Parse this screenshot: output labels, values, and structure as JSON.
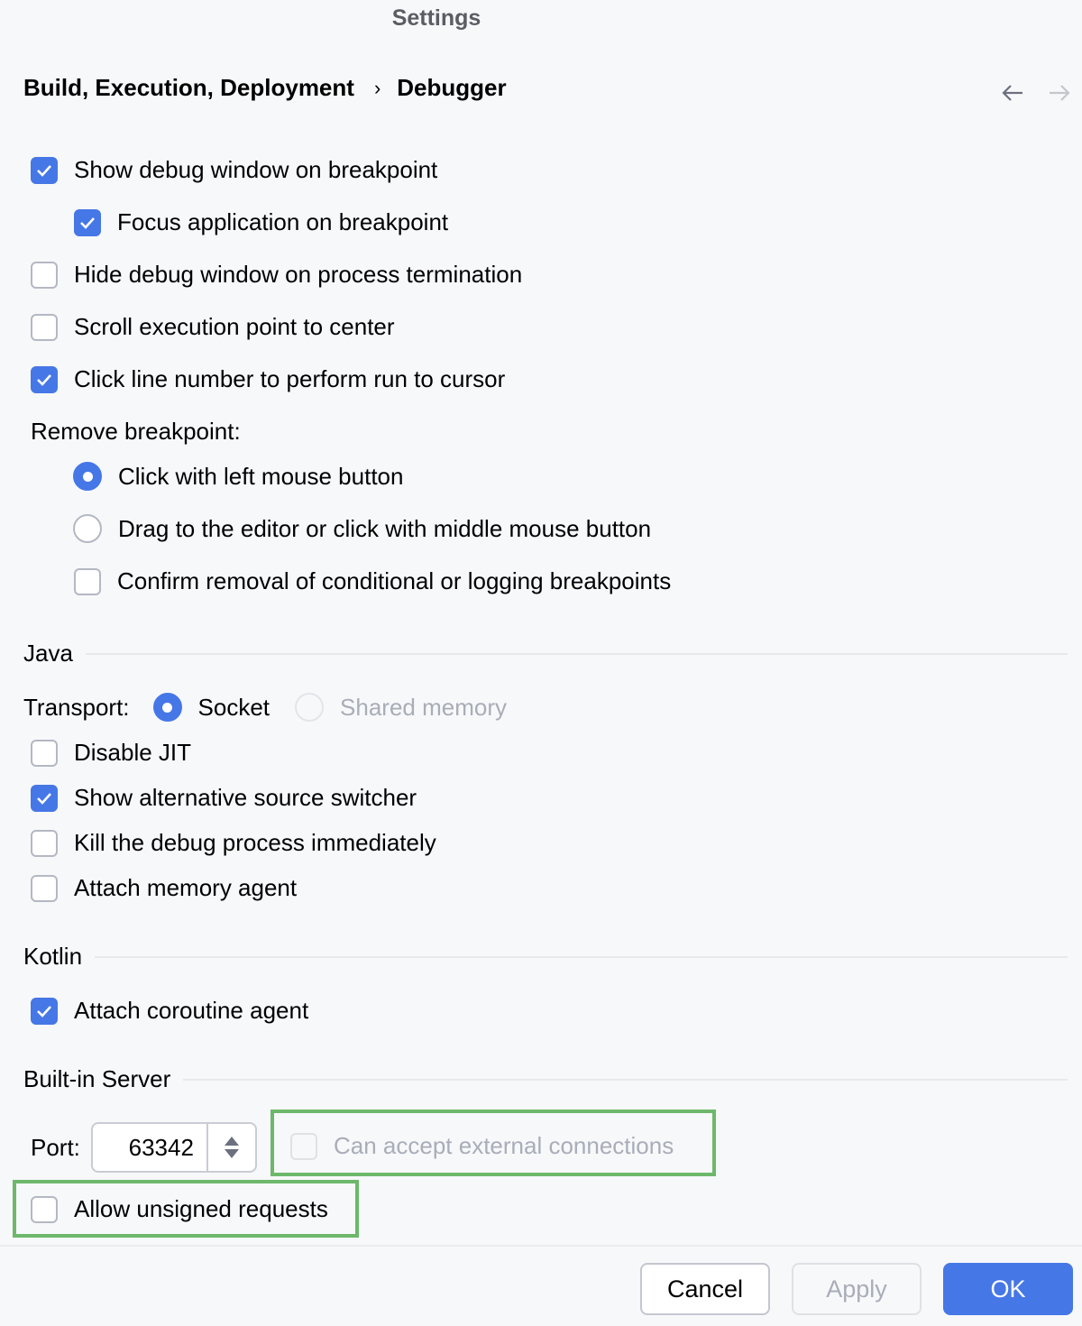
{
  "window": {
    "title": "Settings"
  },
  "breadcrumb": {
    "parent": "Build, Execution, Deployment",
    "separator": "›",
    "current": "Debugger"
  },
  "nav": {
    "back_icon": "arrow-left-icon",
    "forward_icon": "arrow-right-icon"
  },
  "general": {
    "show_debug_window": {
      "label": "Show debug window on breakpoint",
      "checked": true
    },
    "focus_application": {
      "label": "Focus application on breakpoint",
      "checked": true
    },
    "hide_debug_window": {
      "label": "Hide debug window on process termination",
      "checked": false
    },
    "scroll_execution": {
      "label": "Scroll execution point to center",
      "checked": false
    },
    "click_line_number": {
      "label": "Click line number to perform run to cursor",
      "checked": true
    }
  },
  "remove_breakpoint": {
    "label": "Remove breakpoint:",
    "options": [
      {
        "label": "Click with left mouse button",
        "selected": true
      },
      {
        "label": "Drag to the editor or click with middle mouse button",
        "selected": false
      }
    ],
    "confirm_removal": {
      "label": "Confirm removal of conditional or logging breakpoints",
      "checked": false
    }
  },
  "java": {
    "header": "Java",
    "transport_label": "Transport:",
    "transport_options": [
      {
        "label": "Socket",
        "selected": true,
        "enabled": true
      },
      {
        "label": "Shared memory",
        "selected": false,
        "enabled": false
      }
    ],
    "disable_jit": {
      "label": "Disable JIT",
      "checked": false
    },
    "alt_source_switcher": {
      "label": "Show alternative source switcher",
      "checked": true
    },
    "kill_debug_process": {
      "label": "Kill the debug process immediately",
      "checked": false
    },
    "attach_memory_agent": {
      "label": "Attach memory agent",
      "checked": false
    }
  },
  "kotlin": {
    "header": "Kotlin",
    "attach_coroutine_agent": {
      "label": "Attach coroutine agent",
      "checked": true
    }
  },
  "server": {
    "header": "Built-in Server",
    "port_label": "Port:",
    "port_value": "63342",
    "external_connections": {
      "label": "Can accept external connections",
      "checked": false,
      "enabled": false
    },
    "unsigned_requests": {
      "label": "Allow unsigned requests",
      "checked": false
    }
  },
  "footer": {
    "cancel": "Cancel",
    "apply": "Apply",
    "ok": "OK"
  },
  "colors": {
    "accent": "#4677e6",
    "highlight": "#6db86b"
  }
}
